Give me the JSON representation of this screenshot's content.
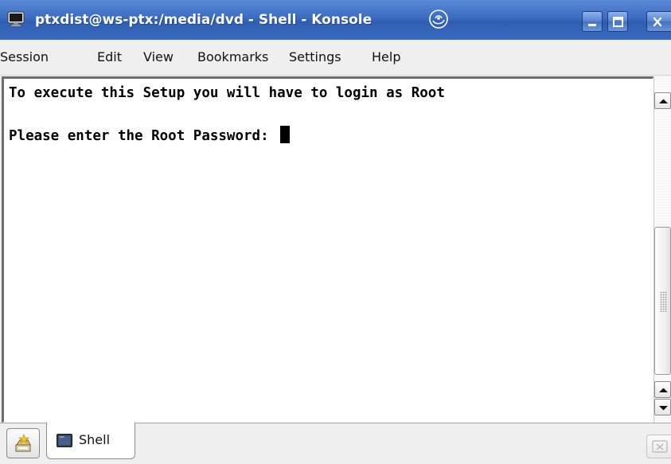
{
  "window": {
    "title": "ptxdist@ws-ptx:/media/dvd - Shell - Konsole",
    "app_icon": "konsole-monitor-icon",
    "title_decoration_icon": "suse-swirl-icon",
    "controls": {
      "minimize_icon": "minimize-icon",
      "maximize_icon": "maximize-icon",
      "close_icon": "close-icon"
    }
  },
  "menubar": {
    "items": [
      "Session",
      "Edit",
      "View",
      "Bookmarks",
      "Settings",
      "Help"
    ]
  },
  "terminal": {
    "lines": [
      "To execute this Setup you will have to login as Root",
      "Please enter the Root Password: "
    ],
    "colors": {
      "background": "#ffffff",
      "foreground": "#000000"
    }
  },
  "tabs": {
    "new_session_icon": "new-session-icon",
    "items": [
      {
        "label": "Shell",
        "icon": "terminal-icon",
        "active": true
      }
    ],
    "close_session_icon": "close-session-icon"
  },
  "theme": {
    "titlebar_color": "#3c6cc0",
    "chrome_color": "#efefef"
  }
}
